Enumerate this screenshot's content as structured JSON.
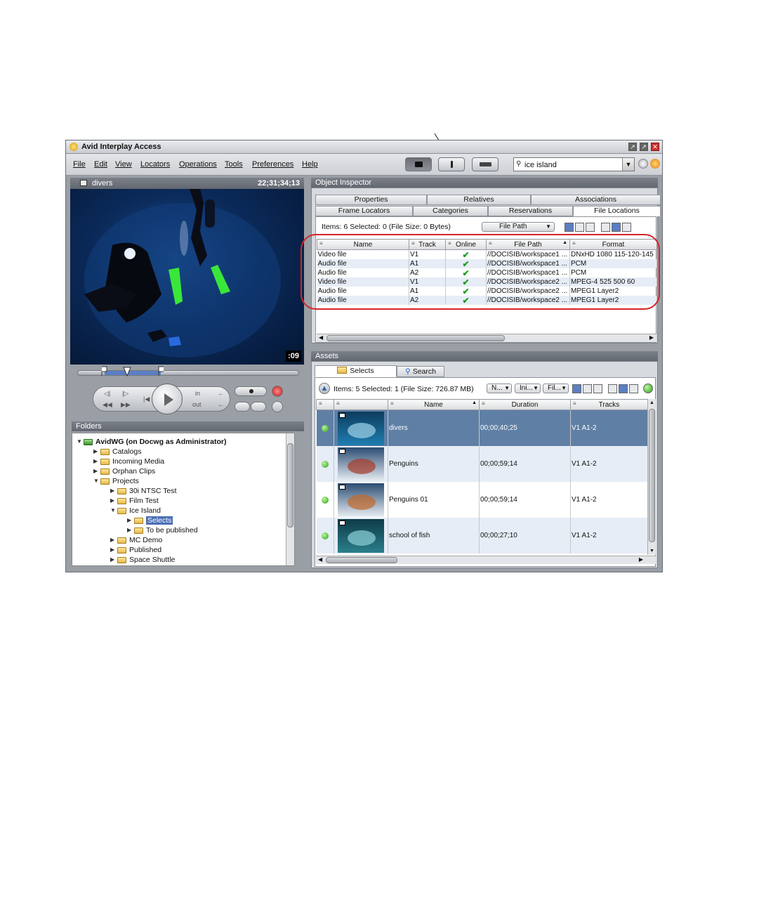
{
  "window": {
    "title": "Avid Interplay Access"
  },
  "menu": [
    "File",
    "Edit",
    "View",
    "Locators",
    "Operations",
    "Tools",
    "Preferences",
    "Help"
  ],
  "search": {
    "value": "ice island"
  },
  "video": {
    "clip_name": "divers",
    "timecode": "22;31;34;13",
    "counter": ":09"
  },
  "transport": {
    "in_label": "in",
    "out_label": "out"
  },
  "folders": {
    "title": "Folders",
    "root": "AvidWG (on Docwg as Administrator)",
    "items": [
      {
        "label": "Catalogs",
        "level": 1,
        "expanded": false
      },
      {
        "label": "Incoming Media",
        "level": 1,
        "expanded": false
      },
      {
        "label": "Orphan Clips",
        "level": 1,
        "expanded": false
      },
      {
        "label": "Projects",
        "level": 1,
        "expanded": true
      },
      {
        "label": "30i NTSC Test",
        "level": 2,
        "expanded": false
      },
      {
        "label": "Film Test",
        "level": 2,
        "expanded": false
      },
      {
        "label": "Ice Island",
        "level": 2,
        "expanded": true
      },
      {
        "label": "Selects",
        "level": 3,
        "expanded": false,
        "selected": true
      },
      {
        "label": "To be published",
        "level": 3,
        "expanded": false
      },
      {
        "label": "MC Demo",
        "level": 2,
        "expanded": false
      },
      {
        "label": "Published",
        "level": 2,
        "expanded": false
      },
      {
        "label": "Space Shuttle",
        "level": 2,
        "expanded": false
      }
    ]
  },
  "inspector": {
    "title": "Object Inspector",
    "tabs_row1": [
      "Properties",
      "Relatives",
      "Associations"
    ],
    "tabs_row2": [
      "Frame Locators",
      "Categories",
      "Reservations",
      "File Locations"
    ],
    "active_tab": "File Locations",
    "items_info": "Items: 6 Selected: 0 (File Size: 0 Bytes)",
    "sort_dropdown": "File Path",
    "columns": [
      "Name",
      "Track",
      "Online",
      "File Path",
      "Format"
    ],
    "rows": [
      {
        "name": "Video file",
        "track": "V1",
        "path": "//DOCISIB/workspace1 ...",
        "format": "DNxHD 1080 115-120-145"
      },
      {
        "name": "Audio file",
        "track": "A1",
        "path": "//DOCISIB/workspace1 ...",
        "format": "PCM"
      },
      {
        "name": "Audio file",
        "track": "A2",
        "path": "//DOCISIB/workspace1 ...",
        "format": "PCM"
      },
      {
        "name": "Video file",
        "track": "V1",
        "path": "//DOCISIB/workspace2 ...",
        "format": "MPEG-4 525 500 60"
      },
      {
        "name": "Audio file",
        "track": "A1",
        "path": "//DOCISIB/workspace2 ...",
        "format": "MPEG1 Layer2"
      },
      {
        "name": "Audio file",
        "track": "A2",
        "path": "//DOCISIB/workspace2 ...",
        "format": "MPEG1 Layer2"
      }
    ]
  },
  "assets": {
    "title": "Assets",
    "tabs": [
      "Selects",
      "Search"
    ],
    "items_info": "Items: 5 Selected: 1 (File Size: 726.87 MB)",
    "filters": [
      "N...",
      "Ini...",
      "Fil..."
    ],
    "columns": [
      "Name",
      "Duration",
      "Tracks"
    ],
    "rows": [
      {
        "name": "divers",
        "duration": "00;00;40;25",
        "tracks": "V1 A1-2",
        "selected": true
      },
      {
        "name": "Penguins",
        "duration": "00;00;59;14",
        "tracks": "V1 A1-2"
      },
      {
        "name": "Penguins 01",
        "duration": "00;00;59;14",
        "tracks": "V1 A1-2"
      },
      {
        "name": "school of fish",
        "duration": "00;00;27;10",
        "tracks": "V1 A1-2"
      }
    ]
  },
  "colors": {
    "highlight_ring": "#d4242a",
    "selection": "#5f7fa5",
    "online_check": "#1f9b27"
  }
}
